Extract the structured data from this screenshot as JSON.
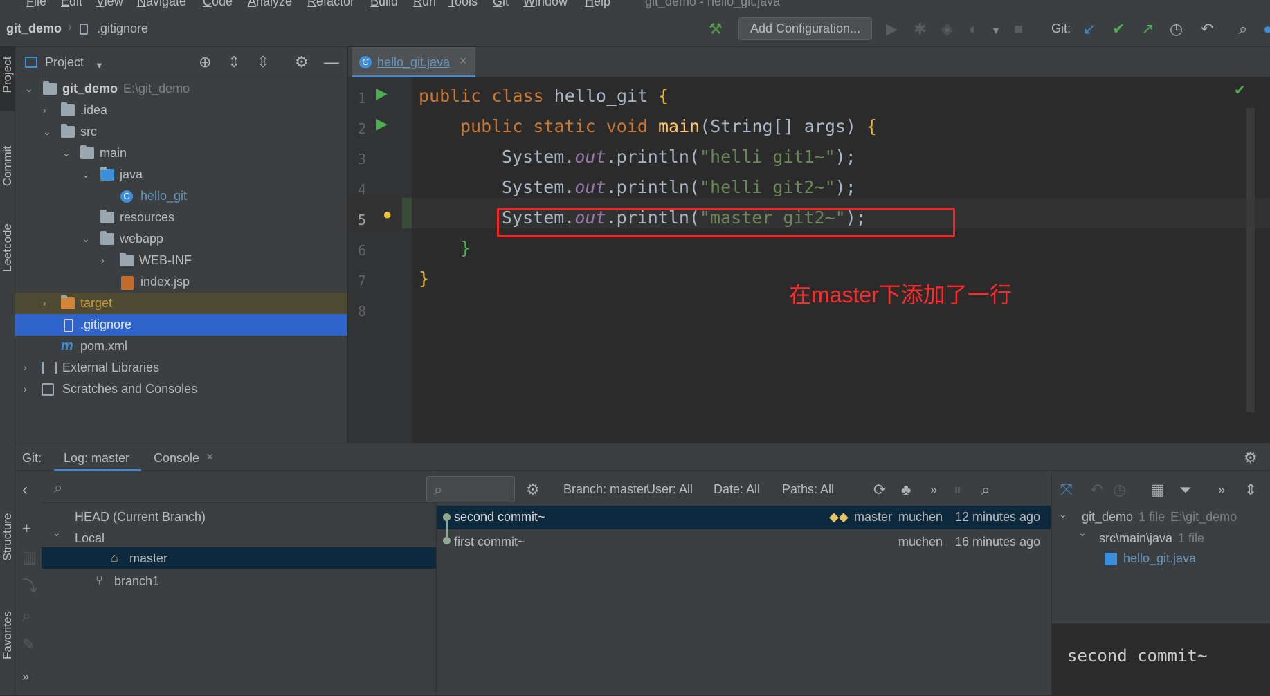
{
  "menu": [
    "File",
    "Edit",
    "View",
    "Navigate",
    "Code",
    "Analyze",
    "Refactor",
    "Build",
    "Run",
    "Tools",
    "Git",
    "Window",
    "Help"
  ],
  "window_title": "git_demo - hello_git.java",
  "breadcrumb": {
    "project": "git_demo",
    "file": ".gitignore"
  },
  "toolbar": {
    "add_config": "Add Configuration...",
    "git_label": "Git:"
  },
  "side_tabs": {
    "project": "Project",
    "commit": "Commit",
    "leetcode": "Leetcode",
    "structure": "Structure",
    "favorites": "Favorites"
  },
  "project_panel": {
    "title": "Project",
    "tree": [
      {
        "label": "git_demo",
        "extra": "E:\\git_demo"
      },
      {
        "label": ".idea"
      },
      {
        "label": "src"
      },
      {
        "label": "main"
      },
      {
        "label": "java"
      },
      {
        "label": "hello_git"
      },
      {
        "label": "resources"
      },
      {
        "label": "webapp"
      },
      {
        "label": "WEB-INF"
      },
      {
        "label": "index.jsp"
      },
      {
        "label": "target"
      },
      {
        "label": ".gitignore"
      },
      {
        "label": "pom.xml"
      },
      {
        "label": "External Libraries"
      },
      {
        "label": "Scratches and Consoles"
      }
    ]
  },
  "editor": {
    "tab": "hello_git.java",
    "line_numbers": [
      "1",
      "2",
      "3",
      "4",
      "5",
      "6",
      "7",
      "8"
    ],
    "code": {
      "l1_kw": "public class ",
      "l1_name": "hello_git ",
      "l1_brace": "{",
      "l2_kw": "public static void ",
      "l2_fn": "main",
      "l2_args": "(String[] args) ",
      "l2_brace": "{",
      "l3_a": "System.",
      "l3_out": "out",
      "l3_b": ".println(",
      "l3_str": "\"helli git1~\"",
      "l3_c": ");",
      "l4_str": "\"helli git2~\"",
      "l5_str": "\"master git2~\"",
      "l6": "}",
      "l7": "}"
    },
    "annotation": "在master下添加了一行",
    "annotation_color": "#ff2a2a"
  },
  "bottom": {
    "git_label": "Git:",
    "tab_log": "Log: master",
    "tab_console": "Console",
    "branches": {
      "head": "HEAD (Current Branch)",
      "local": "Local",
      "master": "master",
      "branch1": "branch1"
    },
    "filters": {
      "branch": "Branch: master",
      "user": "User: All",
      "date": "Date: All",
      "paths": "Paths: All"
    },
    "commits": [
      {
        "msg": "second commit~",
        "tag": "master",
        "author": "muchen",
        "time": "12 minutes ago"
      },
      {
        "msg": "first commit~",
        "tag": "",
        "author": "muchen",
        "time": "16 minutes ago"
      }
    ],
    "changes": {
      "root": "git_demo",
      "root_count": "1 file",
      "root_path": "E:\\git_demo",
      "dir": "src\\main\\java",
      "dir_count": "1 file",
      "file": "hello_git.java"
    },
    "commit_message": "second commit~"
  },
  "colors": {
    "accent": "#2f65ca",
    "selected_commit": "#0d293e",
    "red_box": "#ff2020"
  }
}
